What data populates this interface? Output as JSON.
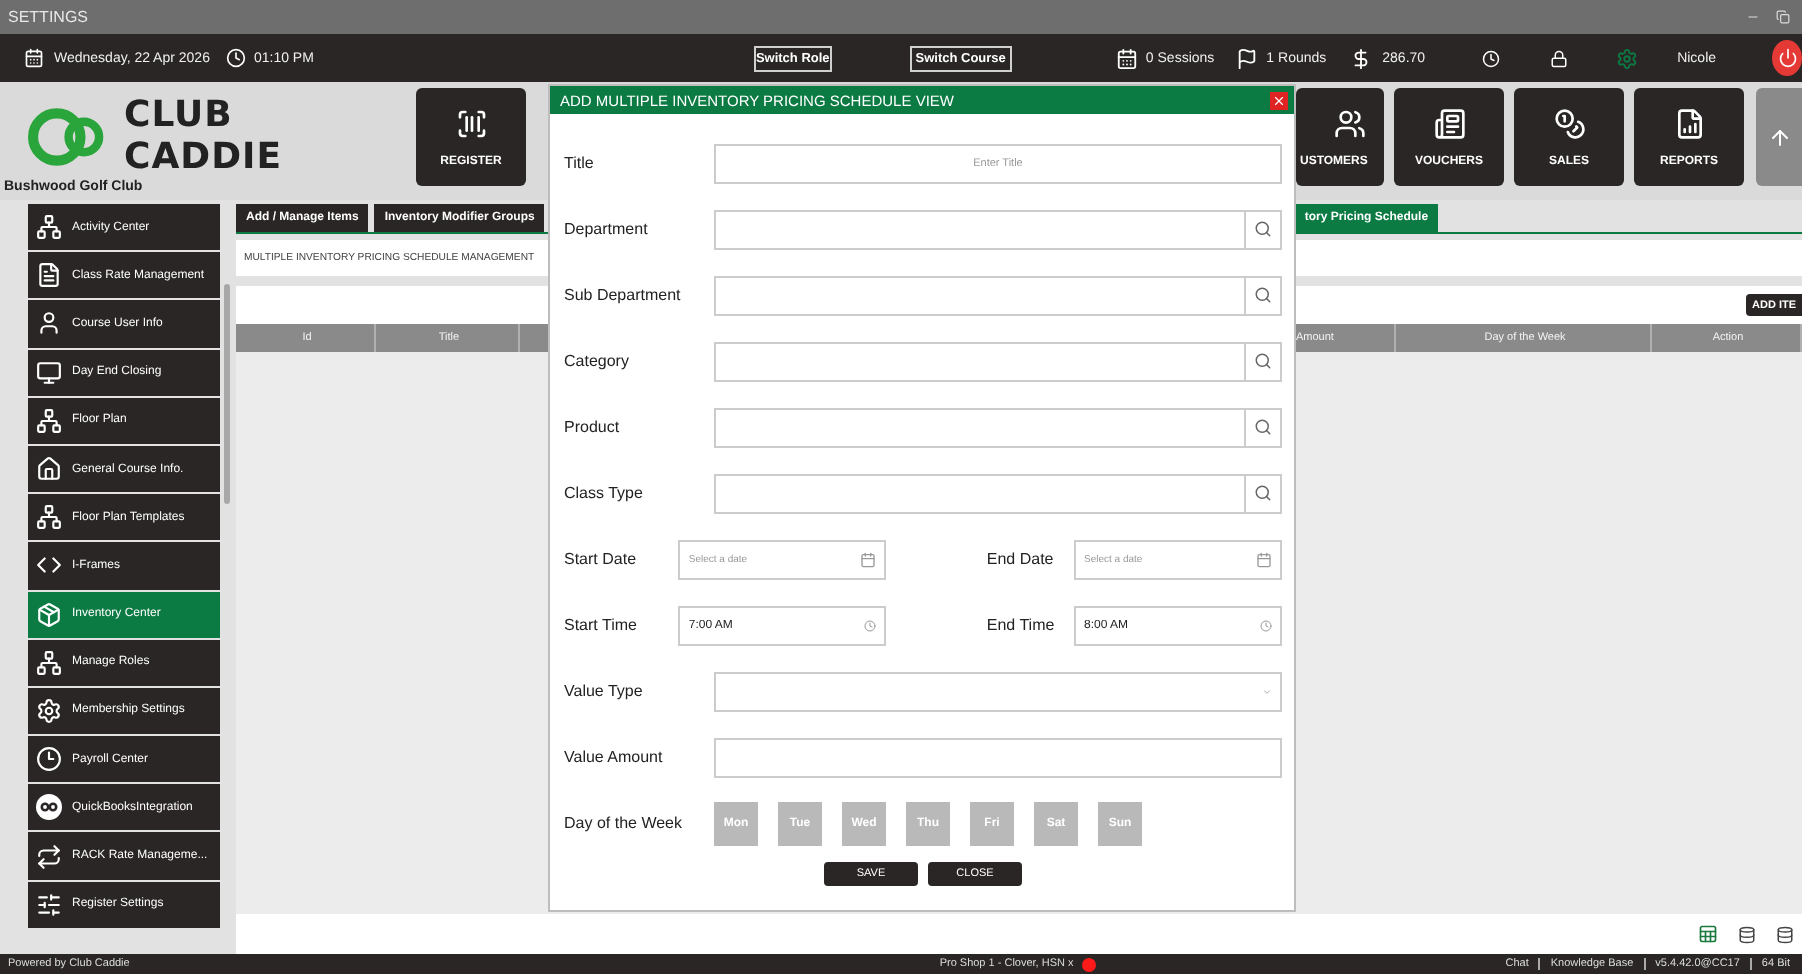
{
  "window": {
    "title": "SETTINGS"
  },
  "top_bar": {
    "date": "Wednesday, 22 Apr 2026",
    "time": "01:10 PM",
    "buttons": [
      "Switch Role",
      "Switch Course"
    ],
    "sessions": "0 Sessions",
    "rounds": "1 Rounds",
    "balance": "286.70",
    "user": "Nicole"
  },
  "logo": {
    "line1": "CLUB",
    "line2": "CADDIE",
    "club": "Bushwood Golf Club"
  },
  "tiles": [
    {
      "label": "REGISTER"
    },
    {
      "label": "USTOMERS"
    },
    {
      "label": "VOUCHERS"
    },
    {
      "label": "SALES"
    },
    {
      "label": "REPORTS"
    }
  ],
  "sidebar": {
    "items": [
      {
        "label": "Activity Center",
        "selected": false
      },
      {
        "label": "Class Rate Management",
        "selected": false
      },
      {
        "label": "Course User Info",
        "selected": false
      },
      {
        "label": "Day End Closing",
        "selected": false
      },
      {
        "label": "Floor Plan",
        "selected": false
      },
      {
        "label": "General Course Info.",
        "selected": false
      },
      {
        "label": "Floor Plan Templates",
        "selected": false
      },
      {
        "label": "I-Frames",
        "selected": false
      },
      {
        "label": "Inventory Center",
        "selected": true
      },
      {
        "label": "Manage Roles",
        "selected": false
      },
      {
        "label": "Membership Settings",
        "selected": false
      },
      {
        "label": "Payroll Center",
        "selected": false
      },
      {
        "label": "QuickBooksIntegration",
        "selected": false
      },
      {
        "label": "RACK Rate Manageme...",
        "selected": false
      },
      {
        "label": "Register Settings",
        "selected": false
      }
    ]
  },
  "tabs": [
    {
      "label": "Add / Manage Items",
      "selected": false
    },
    {
      "label": "Inventory Modifier Groups",
      "selected": false
    },
    {
      "label": "tory Pricing Schedule",
      "selected": true
    }
  ],
  "section_title": "MULTIPLE INVENTORY PRICING SCHEDULE MANAGEMENT",
  "add_button": "ADD ITE",
  "table": {
    "columns": [
      "Id",
      "Title",
      "Amount",
      "Day of the Week",
      "Action"
    ]
  },
  "modal": {
    "title": "ADD MULTIPLE INVENTORY PRICING SCHEDULE VIEW",
    "rows": [
      {
        "kind": "text",
        "label": "Title",
        "placeholder": "Enter Title"
      },
      {
        "kind": "search",
        "label": "Department"
      },
      {
        "kind": "search",
        "label": "Sub Department"
      },
      {
        "kind": "search",
        "label": "Category"
      },
      {
        "kind": "search",
        "label": "Product"
      },
      {
        "kind": "search",
        "label": "Class Type"
      },
      {
        "kind": "pair",
        "fields": [
          {
            "kind": "date",
            "label": "Start Date",
            "placeholder": "Select a date"
          },
          {
            "kind": "date",
            "label": "End Date",
            "placeholder": "Select a date"
          }
        ]
      },
      {
        "kind": "pair",
        "fields": [
          {
            "kind": "time",
            "label": "Start Time",
            "value": "7:00 AM"
          },
          {
            "kind": "time",
            "label": "End Time",
            "value": "8:00 AM"
          }
        ]
      },
      {
        "kind": "select",
        "label": "Value Type"
      },
      {
        "kind": "input",
        "label": "Value Amount"
      },
      {
        "kind": "days",
        "label": "Day of the Week",
        "days": [
          {
            "label": "Mon",
            "selected": false
          },
          {
            "label": "Tue",
            "selected": false
          },
          {
            "label": "Wed",
            "selected": false
          },
          {
            "label": "Thu",
            "selected": false
          },
          {
            "label": "Fri",
            "selected": false
          },
          {
            "label": "Sat",
            "selected": false
          },
          {
            "label": "Sun",
            "selected": false
          }
        ]
      }
    ],
    "buttons": [
      "SAVE",
      "CLOSE"
    ]
  },
  "status_bar": {
    "left": "Powered by Club Caddie",
    "center": "Pro Shop 1 - Clover, HSN x",
    "links": [
      "Chat",
      "Knowledge Base"
    ],
    "version": "v5.4.42.0@CC17",
    "bits": "64 Bit"
  }
}
